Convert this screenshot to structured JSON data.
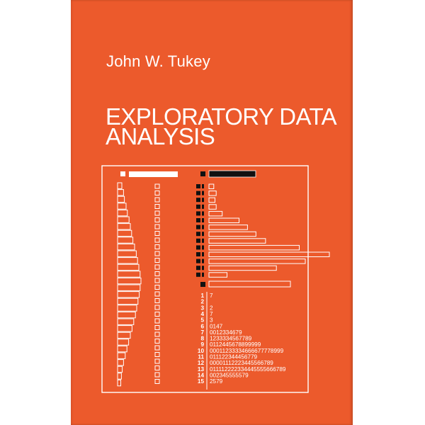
{
  "book": {
    "author": "John W. Tukey",
    "title_line1": "EXPLORATORY DATA",
    "title_line2": "ANALYSIS"
  },
  "colors": {
    "cover": "#ec5a2c",
    "ink": "#ffffff",
    "dark": "#111111"
  },
  "art": {
    "left_bar_widths": [
      0.1,
      0.18,
      0.22,
      0.3,
      0.36,
      0.44,
      0.5,
      0.56,
      0.62,
      0.7,
      0.78,
      0.84,
      0.9,
      0.96,
      1.0,
      0.96,
      0.92,
      0.86,
      0.8,
      0.74,
      0.66,
      0.58,
      0.5,
      0.42,
      0.34,
      0.26,
      0.18,
      0.12,
      0.08,
      0.05
    ],
    "histogram_bars": [
      0.04,
      0.06,
      0.05,
      0.06,
      0.11,
      0.25,
      0.32,
      0.39,
      0.47,
      0.75,
      1.0,
      0.8,
      0.56,
      0.15
    ],
    "stem_leaf": [
      {
        "stem": "1",
        "leaves": "7"
      },
      {
        "stem": "2",
        "leaves": ""
      },
      {
        "stem": "3",
        "leaves": "2"
      },
      {
        "stem": "4",
        "leaves": "7"
      },
      {
        "stem": "5",
        "leaves": "3"
      },
      {
        "stem": "6",
        "leaves": "0147"
      },
      {
        "stem": "7",
        "leaves": "0012334679"
      },
      {
        "stem": "8",
        "leaves": "1233334567789"
      },
      {
        "stem": "9",
        "leaves": "0112445678899999"
      },
      {
        "stem": "10",
        "leaves": "00011233334666677778999"
      },
      {
        "stem": "11",
        "leaves": "011122344456779"
      },
      {
        "stem": "12",
        "leaves": "00001112223445566789"
      },
      {
        "stem": "13",
        "leaves": "011112222334445555666789"
      },
      {
        "stem": "14",
        "leaves": "002345555579"
      },
      {
        "stem": "15",
        "leaves": "2579"
      }
    ]
  }
}
